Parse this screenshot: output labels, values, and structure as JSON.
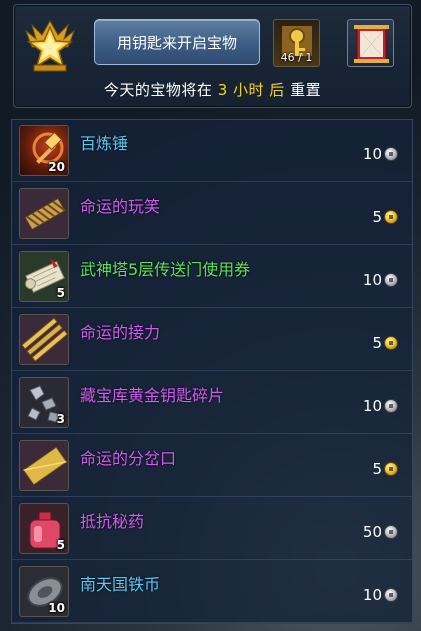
{
  "header": {
    "open_button_label": "用钥匙来开启宝物",
    "key_count": "46 / 1",
    "reset_prefix": "今天的宝物将在 ",
    "reset_hours": "3 小时 后",
    "reset_suffix": " 重置",
    "shop_icon_char": "商"
  },
  "colors": {
    "name_blue": "#5cc8f0",
    "name_purple": "#d05cf0",
    "name_green": "#5fe05a",
    "hours_yellow": "#f7d21d"
  },
  "items": [
    {
      "name": "百炼锤",
      "qty": "20",
      "price": "10",
      "currency": "silver",
      "rarity": "blue",
      "icon": "hammer-icon"
    },
    {
      "name": "命运的玩笑",
      "qty": "",
      "price": "5",
      "currency": "gold",
      "rarity": "purple",
      "icon": "woven-ribbon-icon"
    },
    {
      "name": "武神塔5层传送门使用券",
      "qty": "5",
      "price": "10",
      "currency": "silver",
      "rarity": "green",
      "icon": "scroll-icon"
    },
    {
      "name": "命运的接力",
      "qty": "",
      "price": "5",
      "currency": "gold",
      "rarity": "purple",
      "icon": "golden-bars-icon"
    },
    {
      "name": "藏宝库黄金钥匙碎片",
      "qty": "3",
      "price": "10",
      "currency": "silver",
      "rarity": "purple",
      "icon": "key-fragments-icon"
    },
    {
      "name": "命运的分岔口",
      "qty": "",
      "price": "5",
      "currency": "gold",
      "rarity": "purple",
      "icon": "gold-ingot-icon"
    },
    {
      "name": "抵抗秘药",
      "qty": "5",
      "price": "50",
      "currency": "silver",
      "rarity": "purple",
      "icon": "potion-icon"
    },
    {
      "name": "南天国铁币",
      "qty": "10",
      "price": "10",
      "currency": "silver",
      "rarity": "blue",
      "icon": "iron-coin-icon"
    }
  ]
}
